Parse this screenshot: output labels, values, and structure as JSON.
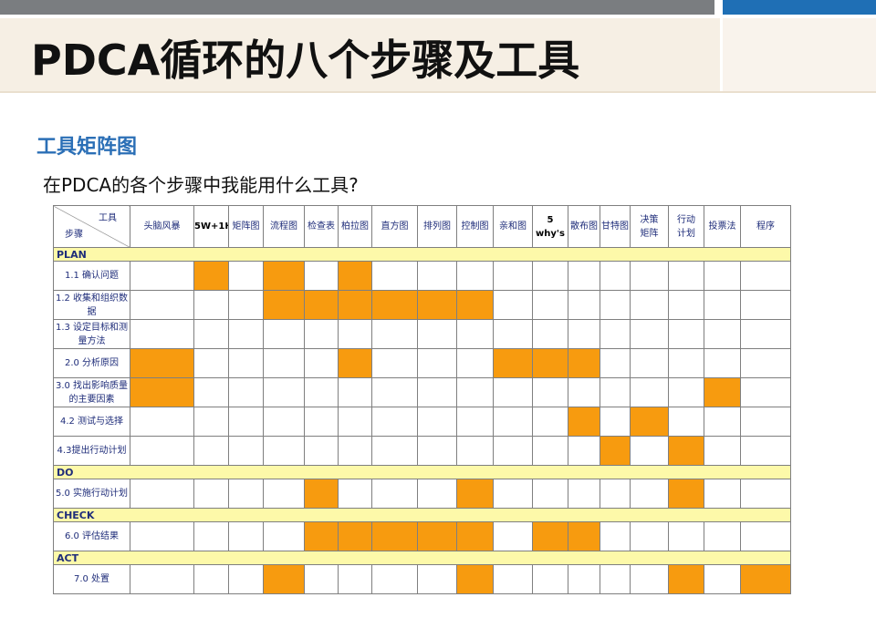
{
  "title": "PDCA循环的八个步骤及工具",
  "subtitle": "工具矩阵图",
  "question": "在PDCA的各个步骤中我能用什么工具?",
  "colors": {
    "highlight": "#f79b0f",
    "phase_row": "#fdf9a9",
    "accent_blue": "#1f6fb5"
  },
  "matrix": {
    "corner_tool": "工具",
    "corner_step": "步骤",
    "tools": [
      {
        "line1": "头脑风暴",
        "line2": ""
      },
      {
        "line1": "5W+1H",
        "line2": ""
      },
      {
        "line1": "矩阵图",
        "line2": ""
      },
      {
        "line1": "流程图",
        "line2": ""
      },
      {
        "line1": "检查表",
        "line2": ""
      },
      {
        "line1": "柏拉图",
        "line2": ""
      },
      {
        "line1": "直方图",
        "line2": ""
      },
      {
        "line1": "排列图",
        "line2": ""
      },
      {
        "line1": "控制图",
        "line2": ""
      },
      {
        "line1": "亲和图",
        "line2": ""
      },
      {
        "line1": "5 why's",
        "line2": ""
      },
      {
        "line1": "散布图",
        "line2": ""
      },
      {
        "line1": "甘特图",
        "line2": ""
      },
      {
        "line1": "决策",
        "line2": "矩阵"
      },
      {
        "line1": "行动",
        "line2": "计划"
      },
      {
        "line1": "投票法",
        "line2": ""
      },
      {
        "line1": "程序",
        "line2": ""
      }
    ],
    "phases": [
      {
        "name": "PLAN",
        "steps": [
          {
            "label": "1.1 确认问题",
            "marks": [
              0,
              1,
              0,
              1,
              0,
              1,
              0,
              0,
              0,
              0,
              0,
              0,
              0,
              0,
              0,
              0,
              0
            ]
          },
          {
            "label": "1.2 收集和组织数据",
            "marks": [
              0,
              0,
              0,
              1,
              1,
              1,
              1,
              1,
              1,
              0,
              0,
              0,
              0,
              0,
              0,
              0,
              0
            ]
          },
          {
            "label": "1.3 设定目标和测量方法",
            "marks": [
              0,
              0,
              0,
              0,
              0,
              0,
              0,
              0,
              0,
              0,
              0,
              0,
              0,
              0,
              0,
              0,
              0
            ]
          },
          {
            "label": "2.0 分析原因",
            "marks": [
              1,
              0,
              0,
              0,
              0,
              1,
              0,
              0,
              0,
              1,
              1,
              1,
              0,
              0,
              0,
              0,
              0
            ]
          },
          {
            "label": "3.0 找出影响质量的主要因素",
            "marks": [
              1,
              0,
              0,
              0,
              0,
              0,
              0,
              0,
              0,
              0,
              0,
              0,
              0,
              0,
              0,
              1,
              0
            ]
          },
          {
            "label": "4.2 测试与选择",
            "marks": [
              0,
              0,
              0,
              0,
              0,
              0,
              0,
              0,
              0,
              0,
              0,
              1,
              0,
              1,
              0,
              0,
              0
            ]
          },
          {
            "label": "4.3提出行动计划",
            "marks": [
              0,
              0,
              0,
              0,
              0,
              0,
              0,
              0,
              0,
              0,
              0,
              0,
              1,
              0,
              1,
              0,
              0
            ]
          }
        ]
      },
      {
        "name": "DO",
        "steps": [
          {
            "label": "5.0 实施行动计划",
            "marks": [
              0,
              0,
              0,
              0,
              1,
              0,
              0,
              0,
              1,
              0,
              0,
              0,
              0,
              0,
              1,
              0,
              0
            ]
          }
        ]
      },
      {
        "name": "CHECK",
        "steps": [
          {
            "label": "6.0 评估结果",
            "marks": [
              0,
              0,
              0,
              0,
              1,
              1,
              1,
              1,
              1,
              0,
              1,
              1,
              0,
              0,
              0,
              0,
              0
            ]
          }
        ]
      },
      {
        "name": "ACT",
        "steps": [
          {
            "label": "7.0 处置",
            "marks": [
              0,
              0,
              0,
              1,
              0,
              0,
              0,
              0,
              1,
              0,
              0,
              0,
              0,
              0,
              1,
              0,
              1
            ]
          }
        ]
      }
    ]
  }
}
